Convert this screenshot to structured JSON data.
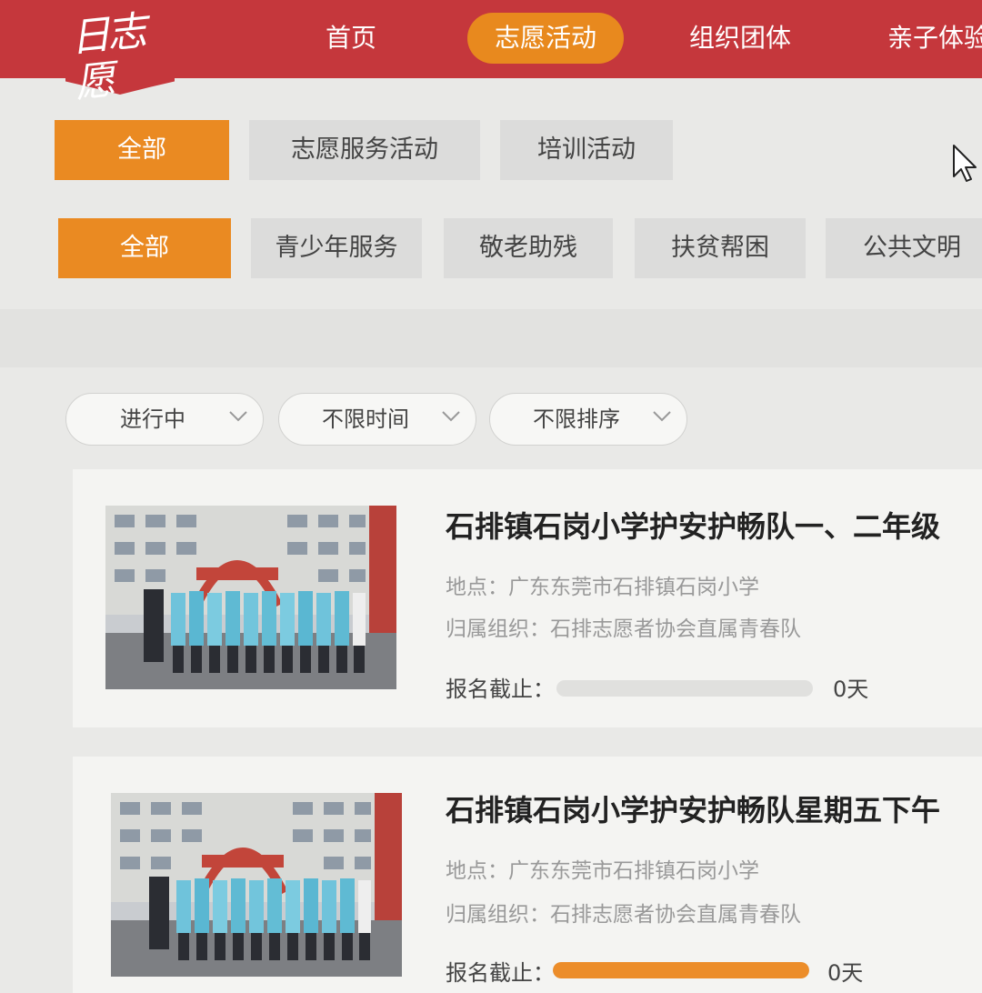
{
  "header": {
    "logo_text": "日志愿",
    "nav": [
      {
        "label": "首页",
        "active": false
      },
      {
        "label": "志愿活动",
        "active": true
      },
      {
        "label": "组织团体",
        "active": false
      },
      {
        "label": "亲子体验",
        "active": false
      }
    ]
  },
  "category_types": [
    {
      "label": "全部",
      "active": true
    },
    {
      "label": "志愿服务活动",
      "active": false
    },
    {
      "label": "培训活动",
      "active": false
    }
  ],
  "service_types": [
    {
      "label": "全部",
      "active": true
    },
    {
      "label": "青少年服务",
      "active": false
    },
    {
      "label": "敬老助残",
      "active": false
    },
    {
      "label": "扶贫帮困",
      "active": false
    },
    {
      "label": "公共文明",
      "active": false
    }
  ],
  "filters": {
    "status": "进行中",
    "time": "不限时间",
    "sort": "不限排序"
  },
  "activities": [
    {
      "title": "石排镇石岗小学护安护畅队一、二年级",
      "location": "地点：广东东莞市石排镇石岗小学",
      "organization": "归属组织：石排志愿者协会直属青春队",
      "deadline_label": "报名截止：",
      "deadline_progress": 0.0,
      "days_left": "0天"
    },
    {
      "title": "石排镇石岗小学护安护畅队星期五下午",
      "location": "地点：广东东莞市石排镇石岗小学",
      "organization": "归属组织：石排志愿者协会直属青春队",
      "deadline_label": "报名截止：",
      "deadline_progress": 1.0,
      "days_left": "0天"
    }
  ],
  "colors": {
    "header_red": "#c5373c",
    "accent_orange": "#ea8a22",
    "button_gray": "#dcdcdb"
  }
}
